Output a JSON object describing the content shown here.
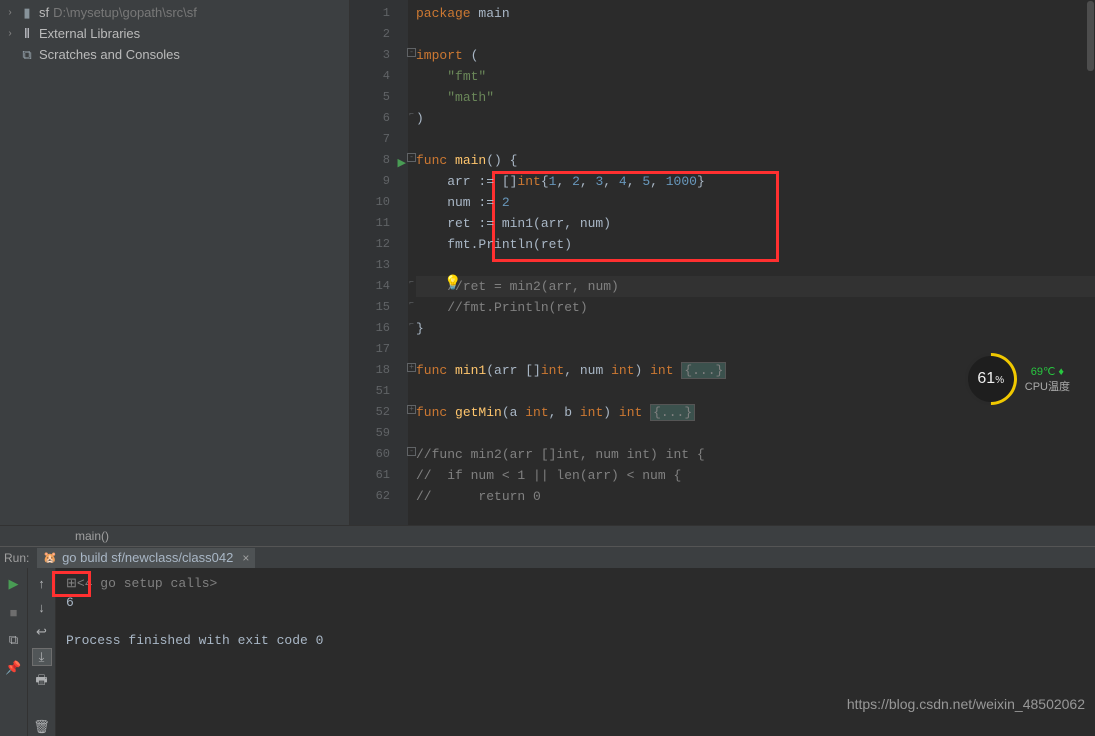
{
  "tree": {
    "project_name": "sf",
    "project_path": "D:\\mysetup\\gopath\\src\\sf",
    "external_libs": "External Libraries",
    "scratches": "Scratches and Consoles"
  },
  "code_lines": [
    {
      "n": "1",
      "cls": "",
      "html": "<span class='kw'>package</span> <span class='ident'>main</span>"
    },
    {
      "n": "2",
      "cls": "",
      "html": ""
    },
    {
      "n": "3",
      "cls": "",
      "fold": "-",
      "html": "<span class='kw'>import</span> ("
    },
    {
      "n": "4",
      "cls": "",
      "html": "    <span class='str'>\"fmt\"</span>"
    },
    {
      "n": "5",
      "cls": "",
      "html": "    <span class='str'>\"math\"</span>"
    },
    {
      "n": "6",
      "cls": "",
      "fold": "e",
      "html": ")"
    },
    {
      "n": "7",
      "cls": "",
      "html": ""
    },
    {
      "n": "8",
      "cls": "",
      "fold": "-",
      "run": true,
      "html": "<span class='kw'>func</span> <span class='fn'>main</span>() {"
    },
    {
      "n": "9",
      "cls": "",
      "html": "    arr := []<span class='typ'>int</span>{<span class='num'>1</span>, <span class='num'>2</span>, <span class='num'>3</span>, <span class='num'>4</span>, <span class='num'>5</span>, <span class='num'>1000</span>}"
    },
    {
      "n": "10",
      "cls": "",
      "html": "    num := <span class='num'>2</span>"
    },
    {
      "n": "11",
      "cls": "",
      "html": "    ret := min1(arr, num)"
    },
    {
      "n": "12",
      "cls": "",
      "html": "    fmt.Println(ret)"
    },
    {
      "n": "13",
      "cls": "",
      "html": ""
    },
    {
      "n": "14",
      "cls": "current-line",
      "fold": "e",
      "bulb": true,
      "html": "    <span class='com'>//ret = min2(arr, num)</span>"
    },
    {
      "n": "15",
      "cls": "",
      "fold": "e",
      "html": "    <span class='com'>//fmt.Println(ret)</span>"
    },
    {
      "n": "16",
      "cls": "",
      "fold": "e",
      "html": "}"
    },
    {
      "n": "17",
      "cls": "",
      "html": ""
    },
    {
      "n": "18",
      "cls": "",
      "fold": "+",
      "html": "<span class='kw'>func</span> <span class='fn'>min1</span>(arr []<span class='typ'>int</span>, num <span class='typ'>int</span>) <span class='typ'>int</span> <span class='folded'>{...}</span>"
    },
    {
      "n": "51",
      "cls": "",
      "html": ""
    },
    {
      "n": "52",
      "cls": "",
      "fold": "+",
      "html": "<span class='kw'>func</span> <span class='fn'>getMin</span>(a <span class='typ'>int</span>, b <span class='typ'>int</span>) <span class='typ'>int</span> <span class='folded'>{...}</span>"
    },
    {
      "n": "59",
      "cls": "",
      "html": ""
    },
    {
      "n": "60",
      "cls": "",
      "fold": "-",
      "html": "<span class='com'>//func min2(arr []int, num int) int {</span>"
    },
    {
      "n": "61",
      "cls": "",
      "html": "<span class='com'>//  if num &lt; 1 || len(arr) &lt; num {</span>"
    },
    {
      "n": "62",
      "cls": "",
      "html": "<span class='com'>//      return 0</span>"
    }
  ],
  "breadcrumb": "main()",
  "run": {
    "label": "Run:",
    "tab": "go build sf/newclass/class042",
    "console_fold": "<4 go setup calls>",
    "result": "6",
    "finish": "Process finished with exit code 0"
  },
  "cpu": {
    "pct": "61",
    "pct_unit": "%",
    "temp": "69℃",
    "temp_label": "CPU温度"
  },
  "watermark": "https://blog.csdn.net/weixin_48502062"
}
